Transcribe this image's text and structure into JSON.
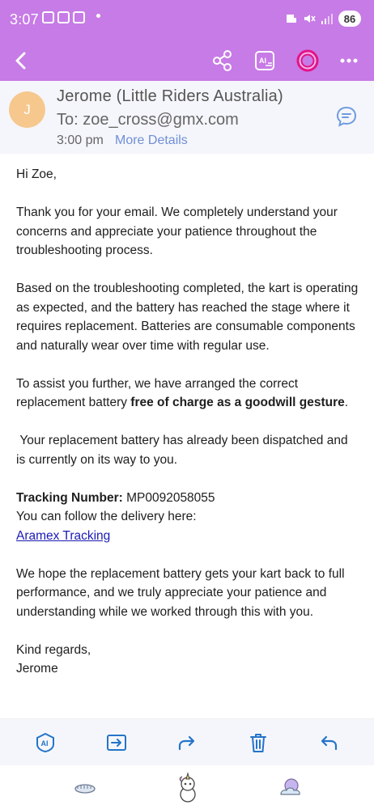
{
  "status_bar": {
    "time": "3:07",
    "battery": "86"
  },
  "app_bar": {
    "back_icon": "chevron-left-icon",
    "actions": [
      "share-icon",
      "ai-summary-icon",
      "ring-icon",
      "more-icon"
    ]
  },
  "header": {
    "avatar_letter": "J",
    "sender": "Jerome (Little Riders Australia)",
    "to": "To: zoe_cross@gmx.com",
    "time": "3:00 pm",
    "more_details": "More Details"
  },
  "email": {
    "greeting": "Hi Zoe,",
    "p1": "Thank you for your email. We completely understand your concerns and appreciate your patience throughout the troubleshooting process.",
    "p2": "Based on the troubleshooting completed, the kart is operating as expected, and the battery has reached the stage where it requires replacement. Batteries are consumable components and naturally wear over time with regular use.",
    "p3_prefix": "To assist you further, we have arranged the correct replacement battery ",
    "p3_bold": "free of charge as a goodwill gesture",
    "p3_suffix": ".",
    "p4": " Your replacement battery has already been dispatched and is currently on its way to you.",
    "tracking_label": "Tracking Number:",
    "tracking_number": " MP0092058055",
    "follow_text": "You can follow the delivery here:",
    "tracking_link": "Aramex Tracking",
    "p6": "We hope the replacement battery gets your kart back to full performance, and we truly appreciate your patience and understanding while we worked through this with you.",
    "sign_off": "Kind regards,",
    "signature": "Jerome"
  },
  "toolbar": {
    "items": [
      "ai-assist-icon",
      "move-icon",
      "forward-icon",
      "delete-icon",
      "reply-icon"
    ]
  },
  "colors": {
    "top_bar": "#c77be6",
    "link": "#1a1ab4",
    "accent_blue": "#2474c9"
  }
}
